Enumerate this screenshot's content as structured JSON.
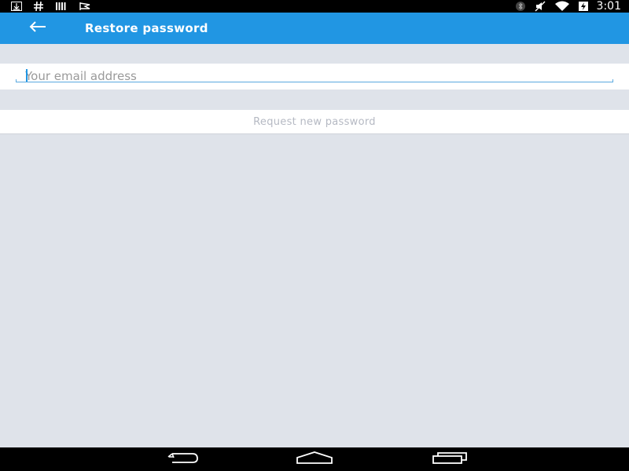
{
  "status_bar": {
    "time": "3:01",
    "left_icons": [
      "download-icon",
      "hashtag-icon",
      "barcode-icon",
      "flag-icon"
    ],
    "right_icons": [
      "bluetooth-icon",
      "mute-icon",
      "wifi-icon",
      "battery-charging-icon"
    ]
  },
  "toolbar": {
    "back_icon": "arrow-left-icon",
    "title": "Restore password",
    "color": "#2196e3"
  },
  "form": {
    "email_placeholder": "Your email address",
    "email_value": "",
    "request_button_label": "Request new password"
  },
  "nav_bar": {
    "buttons": [
      "back-nav-icon",
      "home-nav-icon",
      "recents-nav-icon"
    ]
  },
  "colors": {
    "accent": "#2196e3",
    "background": "#dfe3ea"
  }
}
